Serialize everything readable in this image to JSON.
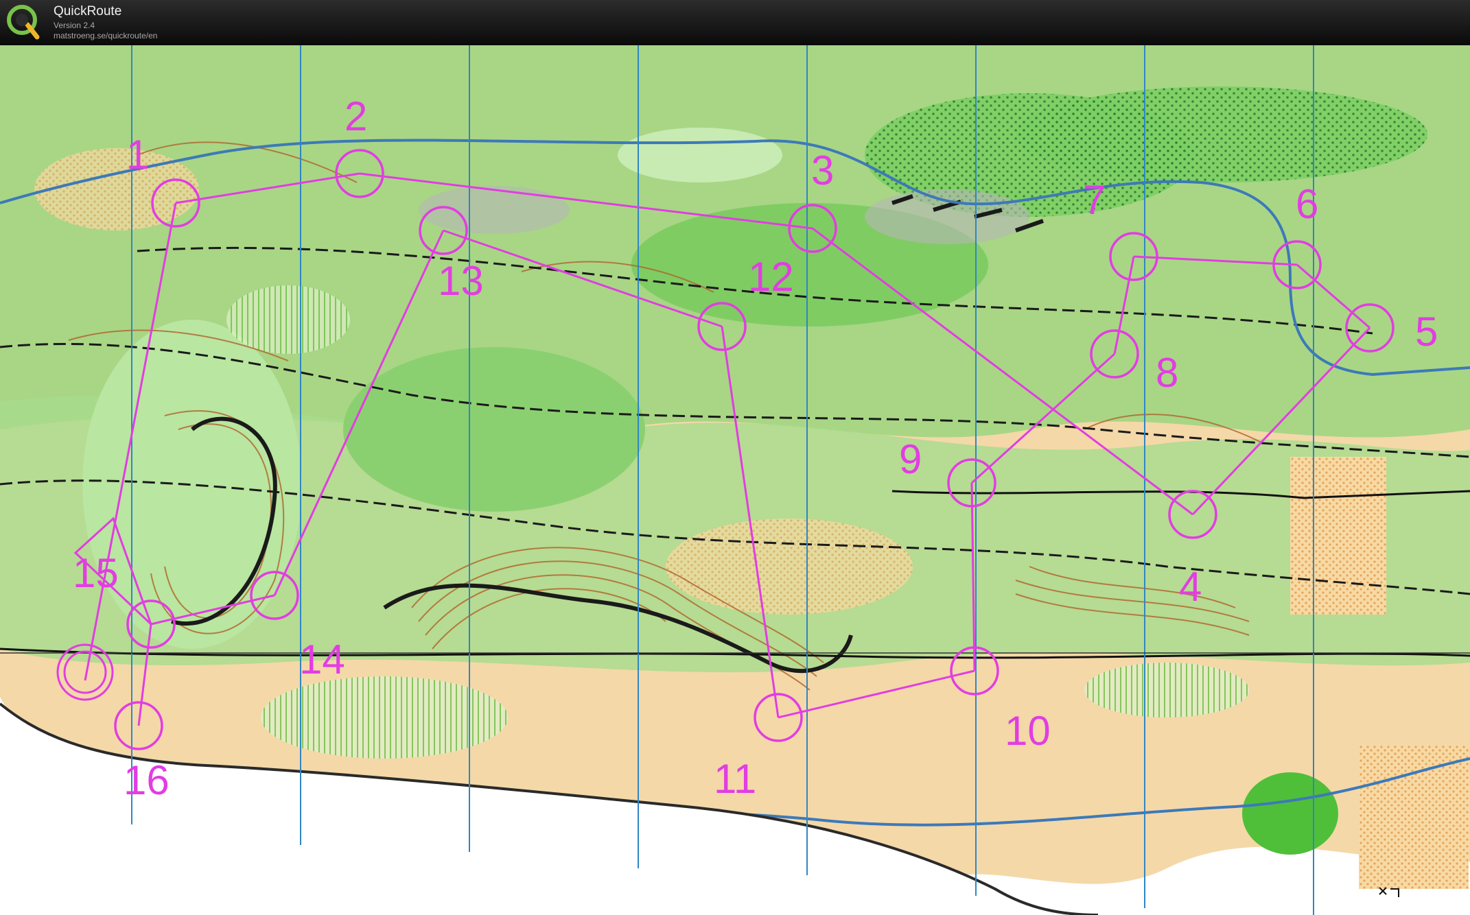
{
  "app": {
    "title": "QuickRoute",
    "version": "Version 2.4",
    "url": "matstroeng.se/quickroute/en"
  },
  "icons": {
    "logo": "quickroute-logo-icon",
    "map_corner": "cursor-icon"
  },
  "colors": {
    "course": "#e23de2",
    "forest": "#8fd37a",
    "open_land": "#f6d9a0",
    "contour": "#b0622c",
    "water": "#3d79b8",
    "magnetic_north_lines": "#2f86c4"
  },
  "course": {
    "start_label": "",
    "controls": [
      {
        "label": "1"
      },
      {
        "label": "2"
      },
      {
        "label": "3"
      },
      {
        "label": "4"
      },
      {
        "label": "5"
      },
      {
        "label": "6"
      },
      {
        "label": "7"
      },
      {
        "label": "8"
      },
      {
        "label": "9"
      },
      {
        "label": "10"
      },
      {
        "label": "11"
      },
      {
        "label": "12"
      },
      {
        "label": "13"
      },
      {
        "label": "14"
      },
      {
        "label": "15"
      },
      {
        "label": "16"
      }
    ]
  }
}
